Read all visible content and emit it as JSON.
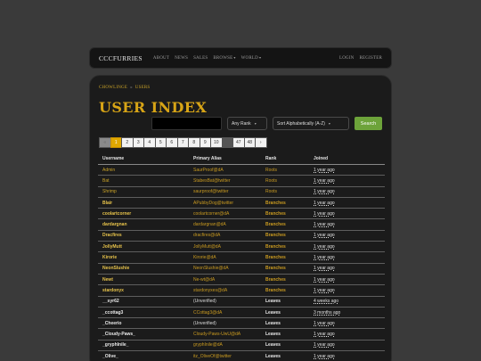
{
  "nav": {
    "brand": "CCCFURRIES",
    "links": [
      "ABOUT",
      "NEWS",
      "SALES",
      "BROWSE",
      "WORLD"
    ],
    "right": [
      "LOGIN",
      "REGISTER"
    ]
  },
  "breadcrumb": [
    "CHOWLINGE",
    "USERS"
  ],
  "page_title": "USER INDEX",
  "search": {
    "value": "",
    "rank_selected": "Any Rank",
    "sort_selected": "Sort Alphabetically (A-Z)",
    "button": "Search"
  },
  "pagination": {
    "prev": "«",
    "pages": [
      "1",
      "2",
      "3",
      "4",
      "5",
      "6",
      "7",
      "8",
      "9",
      "10"
    ],
    "ellipsis": "...",
    "tail": [
      "47",
      "48"
    ],
    "next": "›",
    "current": "1"
  },
  "table": {
    "headers": [
      "Username",
      "Primary Alias",
      "Rank",
      "Joined"
    ],
    "rows": [
      {
        "user": "Admin",
        "alias": "SaurProof@dA",
        "rank": "Roots",
        "joined": "1 year ago"
      },
      {
        "user": "Bat",
        "alias": "StabesBat@twitter",
        "rank": "Roots",
        "joined": "1 year ago"
      },
      {
        "user": "Shrimp",
        "alias": "saurproof@twitter",
        "rank": "Roots",
        "joined": "1 year ago"
      },
      {
        "user": "Blair",
        "alias": "APubbyDog@twitter",
        "rank": "Branches",
        "joined": "1 year ago"
      },
      {
        "user": "coolartcorner",
        "alias": "coolartcorner@dA",
        "rank": "Branches",
        "joined": "1 year ago"
      },
      {
        "user": "dardargnan",
        "alias": "dardargnan@dA",
        "rank": "Branches",
        "joined": "1 year ago"
      },
      {
        "user": "Dracfires",
        "alias": "dracfires@dA",
        "rank": "Branches",
        "joined": "1 year ago"
      },
      {
        "user": "JollyMutt",
        "alias": "JollyMutt@dA",
        "rank": "Branches",
        "joined": "1 year ago"
      },
      {
        "user": "Kirorie",
        "alias": "Kirorie@dA",
        "rank": "Branches",
        "joined": "1 year ago"
      },
      {
        "user": "NeonSlushie",
        "alias": "NeonSlushie@dA",
        "rank": "Branches",
        "joined": "1 year ago"
      },
      {
        "user": "Newt",
        "alias": "Ne-wt@dA",
        "rank": "Branches",
        "joined": "1 year ago"
      },
      {
        "user": "stardonyx",
        "alias": "stardonyxes@dA",
        "rank": "Branches",
        "joined": "1 year ago"
      },
      {
        "user": "__syr62",
        "alias": "(Unverified)",
        "rank": "Leaves",
        "joined": "4 weeks ago"
      },
      {
        "user": "_ccottag3",
        "alias": "CCottag3@dA",
        "rank": "Leaves",
        "joined": "3 months ago"
      },
      {
        "user": "_Cheerio",
        "alias": "(Unverified)",
        "rank": "Leaves",
        "joined": "1 year ago"
      },
      {
        "user": "_Cloudy-Paws_",
        "alias": "Cloudy-Paws-UwU@dA",
        "rank": "Leaves",
        "joined": "1 year ago"
      },
      {
        "user": "_gryphInile_",
        "alias": "gryphInile@dA",
        "rank": "Leaves",
        "joined": "1 year ago"
      },
      {
        "user": "_Olive_",
        "alias": "itz_OliveOf@twitter",
        "rank": "Leaves",
        "joined": "1 year ago"
      }
    ]
  },
  "colors": {
    "accent": "#d7a416",
    "search_button": "#6da33a",
    "page_active": "#e0a800"
  }
}
